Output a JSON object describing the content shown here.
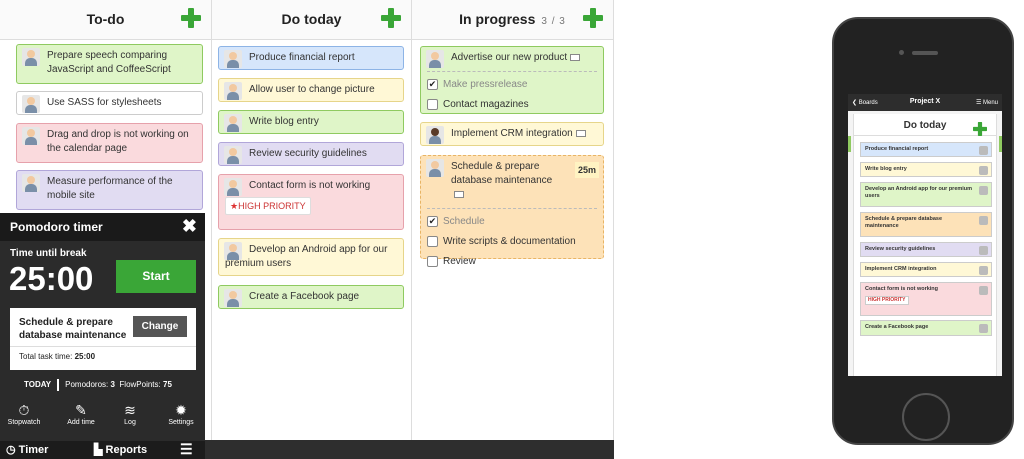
{
  "columns": [
    {
      "title": "To-do",
      "count": ""
    },
    {
      "title": "Do today",
      "count": ""
    },
    {
      "title": "In progress",
      "count": "3 / 3"
    }
  ],
  "todo": [
    "Prepare speech comparing JavaScript and CoffeeScript",
    "Use SASS for stylesheets",
    "Drag and drop is not working on the calendar page",
    "Measure performance of the mobile site"
  ],
  "do_today": {
    "c0": "Produce financial report",
    "c1": "Allow user to change picture",
    "c2": "Write blog entry",
    "c3": "Review security guidelines",
    "c4": "Contact form is not working",
    "c4_badge": "HIGH PRIORITY",
    "c5": "Develop an Android app for our premium users",
    "c6": "Create a Facebook page"
  },
  "in_progress": {
    "c0": "Advertise our new product",
    "c0_items": [
      "Make pressrelease",
      "Contact magazines"
    ],
    "c1": "Implement CRM integration",
    "c2": "Schedule & prepare database maintenance",
    "c2_time": "25m",
    "c2_items": [
      "Schedule",
      "Write scripts & documentation",
      "Review"
    ]
  },
  "pomodoro": {
    "title": "Pomodoro timer",
    "close": "✖",
    "label": "Time until break",
    "time": "25:00",
    "start": "Start",
    "task": "Schedule & prepare database maintenance",
    "change": "Change",
    "total_label": "Total task time:",
    "total_value": "25:00",
    "today": "TODAY",
    "pomodoros_label": "Pomodoros:",
    "pomodoros": "3",
    "flow_label": "FlowPoints:",
    "flow": "75",
    "tools": [
      "Stopwatch",
      "Add time",
      "Log",
      "Settings"
    ],
    "tab_timer": "Timer",
    "tab_reports": "Reports"
  },
  "phone": {
    "back": "❮ Boards",
    "title": "Project X",
    "menu": "☰ Menu",
    "column": "Do today",
    "cards": [
      "Produce financial report",
      "Write blog entry",
      "Develop an Android app for our premium users",
      "Schedule & prepare database maintenance",
      "Review security guidelines",
      "Implement CRM integration",
      "Contact form is not working",
      "Create a Facebook page"
    ],
    "badge": "HIGH PRIORITY"
  },
  "colors": {
    "accent": "#3aa637",
    "dark": "#2b2b2b"
  }
}
